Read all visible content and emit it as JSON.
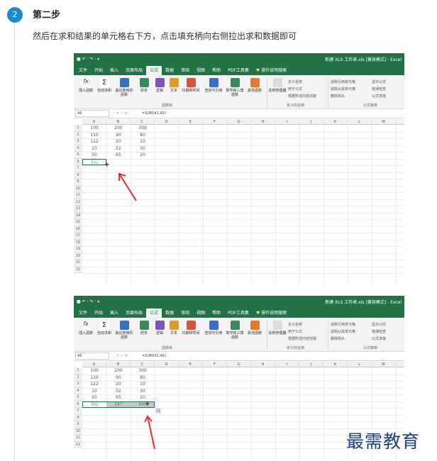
{
  "step": {
    "number": "2",
    "title": "第二步",
    "desc": "然后在求和结果的单元格右下方，点击填充柄向右侧拉出求和数据即可"
  },
  "excel": {
    "window_title": "新建 XLS 工作表.xls [兼容模式] - Excel",
    "qat": "■ ↶ · ↷ · ▾",
    "menu": [
      "文件",
      "开始",
      "插入",
      "页面布局",
      "公式",
      "数据",
      "审阅",
      "视图",
      "帮助",
      "PDF工具集"
    ],
    "tell_me": "操作说明搜索",
    "ribbon": {
      "fx_label": "插入函数",
      "autosum": "自动求和",
      "recent": "最近使用的函数",
      "finance": "财务",
      "logic": "逻辑",
      "text": "文本",
      "datetime": "日期和时间",
      "lookup": "查找与引用",
      "math": "数学和三角函数",
      "other": "其他函数",
      "group_lib": "函数库",
      "name_mgr": "名称管理器",
      "define_name": "定义名称",
      "use_formula": "用于公式",
      "from_sel": "根据所选内容创建",
      "group_names": "定义的名称",
      "trace_prec": "追踪引用单元格",
      "trace_dep": "追踪从属单元格",
      "remove_arrows": "删除箭头",
      "show_formula": "显示公式",
      "error_check": "错误检查",
      "eval_formula": "公式求值",
      "group_audit": "公式审核"
    },
    "name_box": "A6",
    "formula": "=SUM(A1:A5)",
    "columns": [
      "A",
      "B",
      "C",
      "D",
      "E",
      "F",
      "G",
      "H",
      "I",
      "J",
      "K",
      "L",
      "M"
    ],
    "rows": [
      "1",
      "2",
      "3",
      "4",
      "5",
      "6",
      "7",
      "8",
      "9",
      "10",
      "11",
      "12",
      "13",
      "14",
      "15",
      "16",
      "17",
      "18",
      "19",
      "20",
      "21",
      "22"
    ],
    "table": [
      [
        "100",
        "200",
        "300"
      ],
      [
        "110",
        "90",
        "80"
      ],
      [
        "122",
        "20",
        "10"
      ],
      [
        "10",
        "52",
        "30"
      ],
      [
        "50",
        "65",
        "20"
      ]
    ],
    "sum1": "392",
    "sum2": [
      "392",
      "447",
      "440"
    ]
  },
  "watermark": "最需教育",
  "colors": {
    "excel_green": "#217346",
    "step_blue": "#1a8ccf",
    "arrow_red": "#e0302a",
    "watermark": "#1d3c8c"
  }
}
